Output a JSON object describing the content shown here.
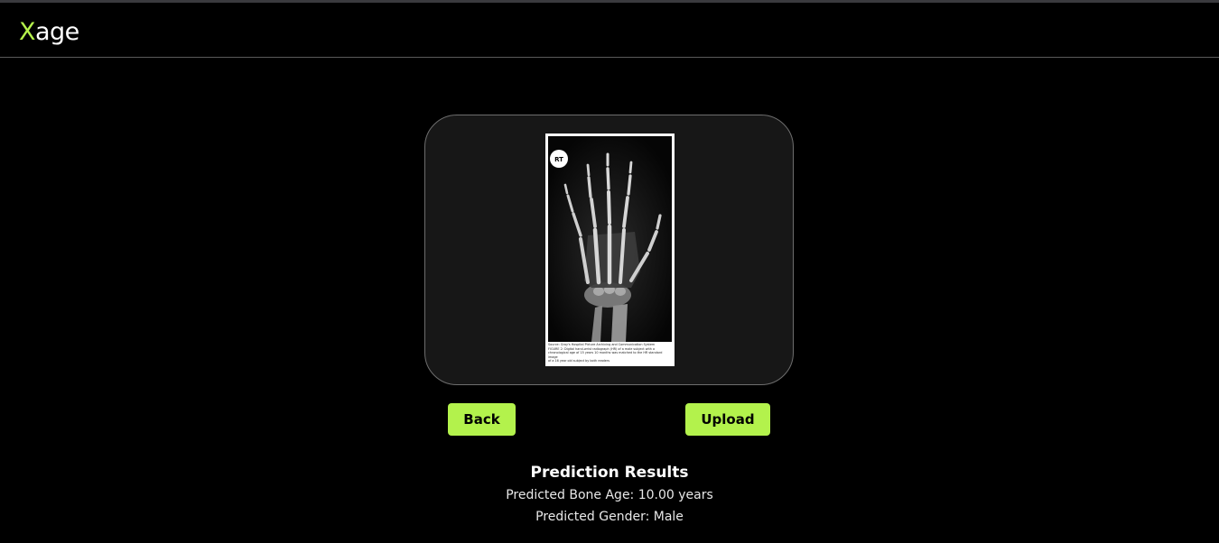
{
  "header": {
    "logo_first": "X",
    "logo_rest": "age"
  },
  "upload_preview": {
    "image_icon": "hand-xray-radiograph",
    "marker": "RT",
    "caption_lines": [
      "Source: Gray's Hospital Picture Archiving and Communication System",
      "FIGURE 2: Digital hand-wrist radiograph (HR) of a male subject with a",
      "chronological age of 15 years 10 months was matched to the HR standard image",
      "of a 16 year old subject by both readers"
    ]
  },
  "actions": {
    "back_label": "Back",
    "upload_label": "Upload"
  },
  "results": {
    "title": "Prediction Results",
    "bone_age": "Predicted Bone Age: 10.00 years",
    "gender": "Predicted Gender: Male"
  },
  "colors": {
    "accent": "#b3f24c",
    "background": "#000000",
    "card": "#171717"
  }
}
